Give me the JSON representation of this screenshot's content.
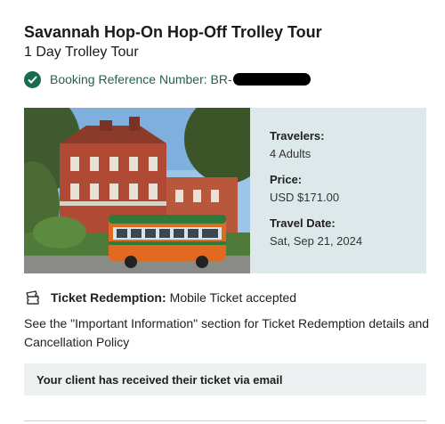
{
  "tour": {
    "title": "Savannah Hop-On Hop-Off Trolley Tour",
    "subtitle": "1 Day Trolley Tour"
  },
  "booking": {
    "label": "Booking Reference Number: BR-",
    "icon": "check-circle-icon"
  },
  "details": {
    "travelers_label": "Travelers:",
    "travelers_value": "4 Adults",
    "price_label": "Price:",
    "price_value": "USD $171.00",
    "date_label": "Travel Date:",
    "date_value": "Sat, Sep 21, 2024"
  },
  "redemption": {
    "icon": "ticket-icon",
    "label": "Ticket Redemption:",
    "value": "Mobile Ticket accepted"
  },
  "info_text": "See the \"Important Information\" section for Ticket Redemption details and Cancellation Policy",
  "notice": "Your client has received their ticket via email",
  "colors": {
    "accent": "#1b6b52",
    "card_bg": "#dde8ea",
    "notice_bg": "#eef1f1"
  }
}
